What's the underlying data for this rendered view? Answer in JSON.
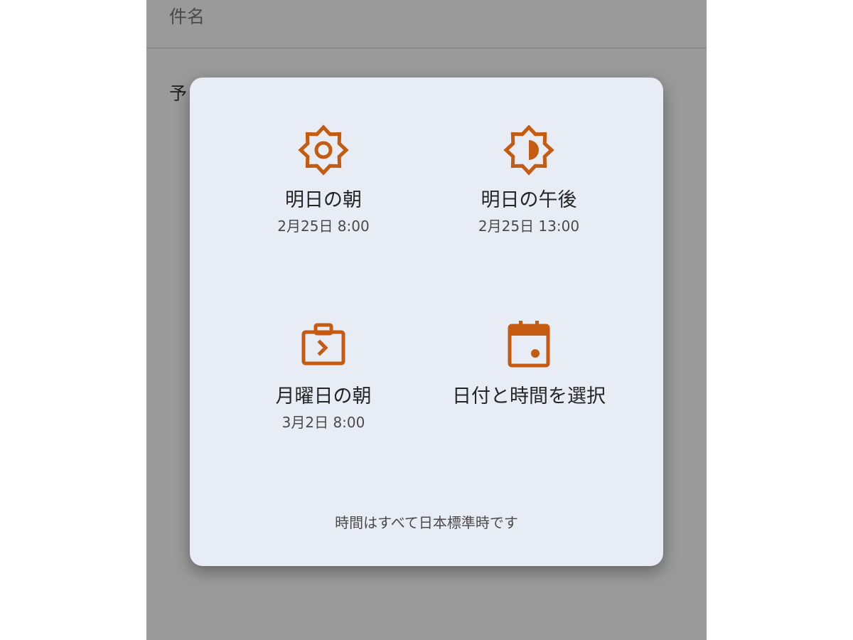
{
  "background": {
    "subject_label": "件名",
    "schedule_label": "予"
  },
  "dialog": {
    "accent_color": "#c55a11",
    "options": [
      {
        "icon": "sun-icon",
        "title": "明日の朝",
        "when": "2月25日 8:00"
      },
      {
        "icon": "half-sun-icon",
        "title": "明日の午後",
        "when": "2月25日 13:00"
      },
      {
        "icon": "briefcase-icon",
        "title": "月曜日の朝",
        "when": "3月2日 8:00"
      },
      {
        "icon": "calendar-icon",
        "title": "日付と時間を選択",
        "when": ""
      }
    ],
    "footer": "時間はすべて日本標準時です"
  }
}
